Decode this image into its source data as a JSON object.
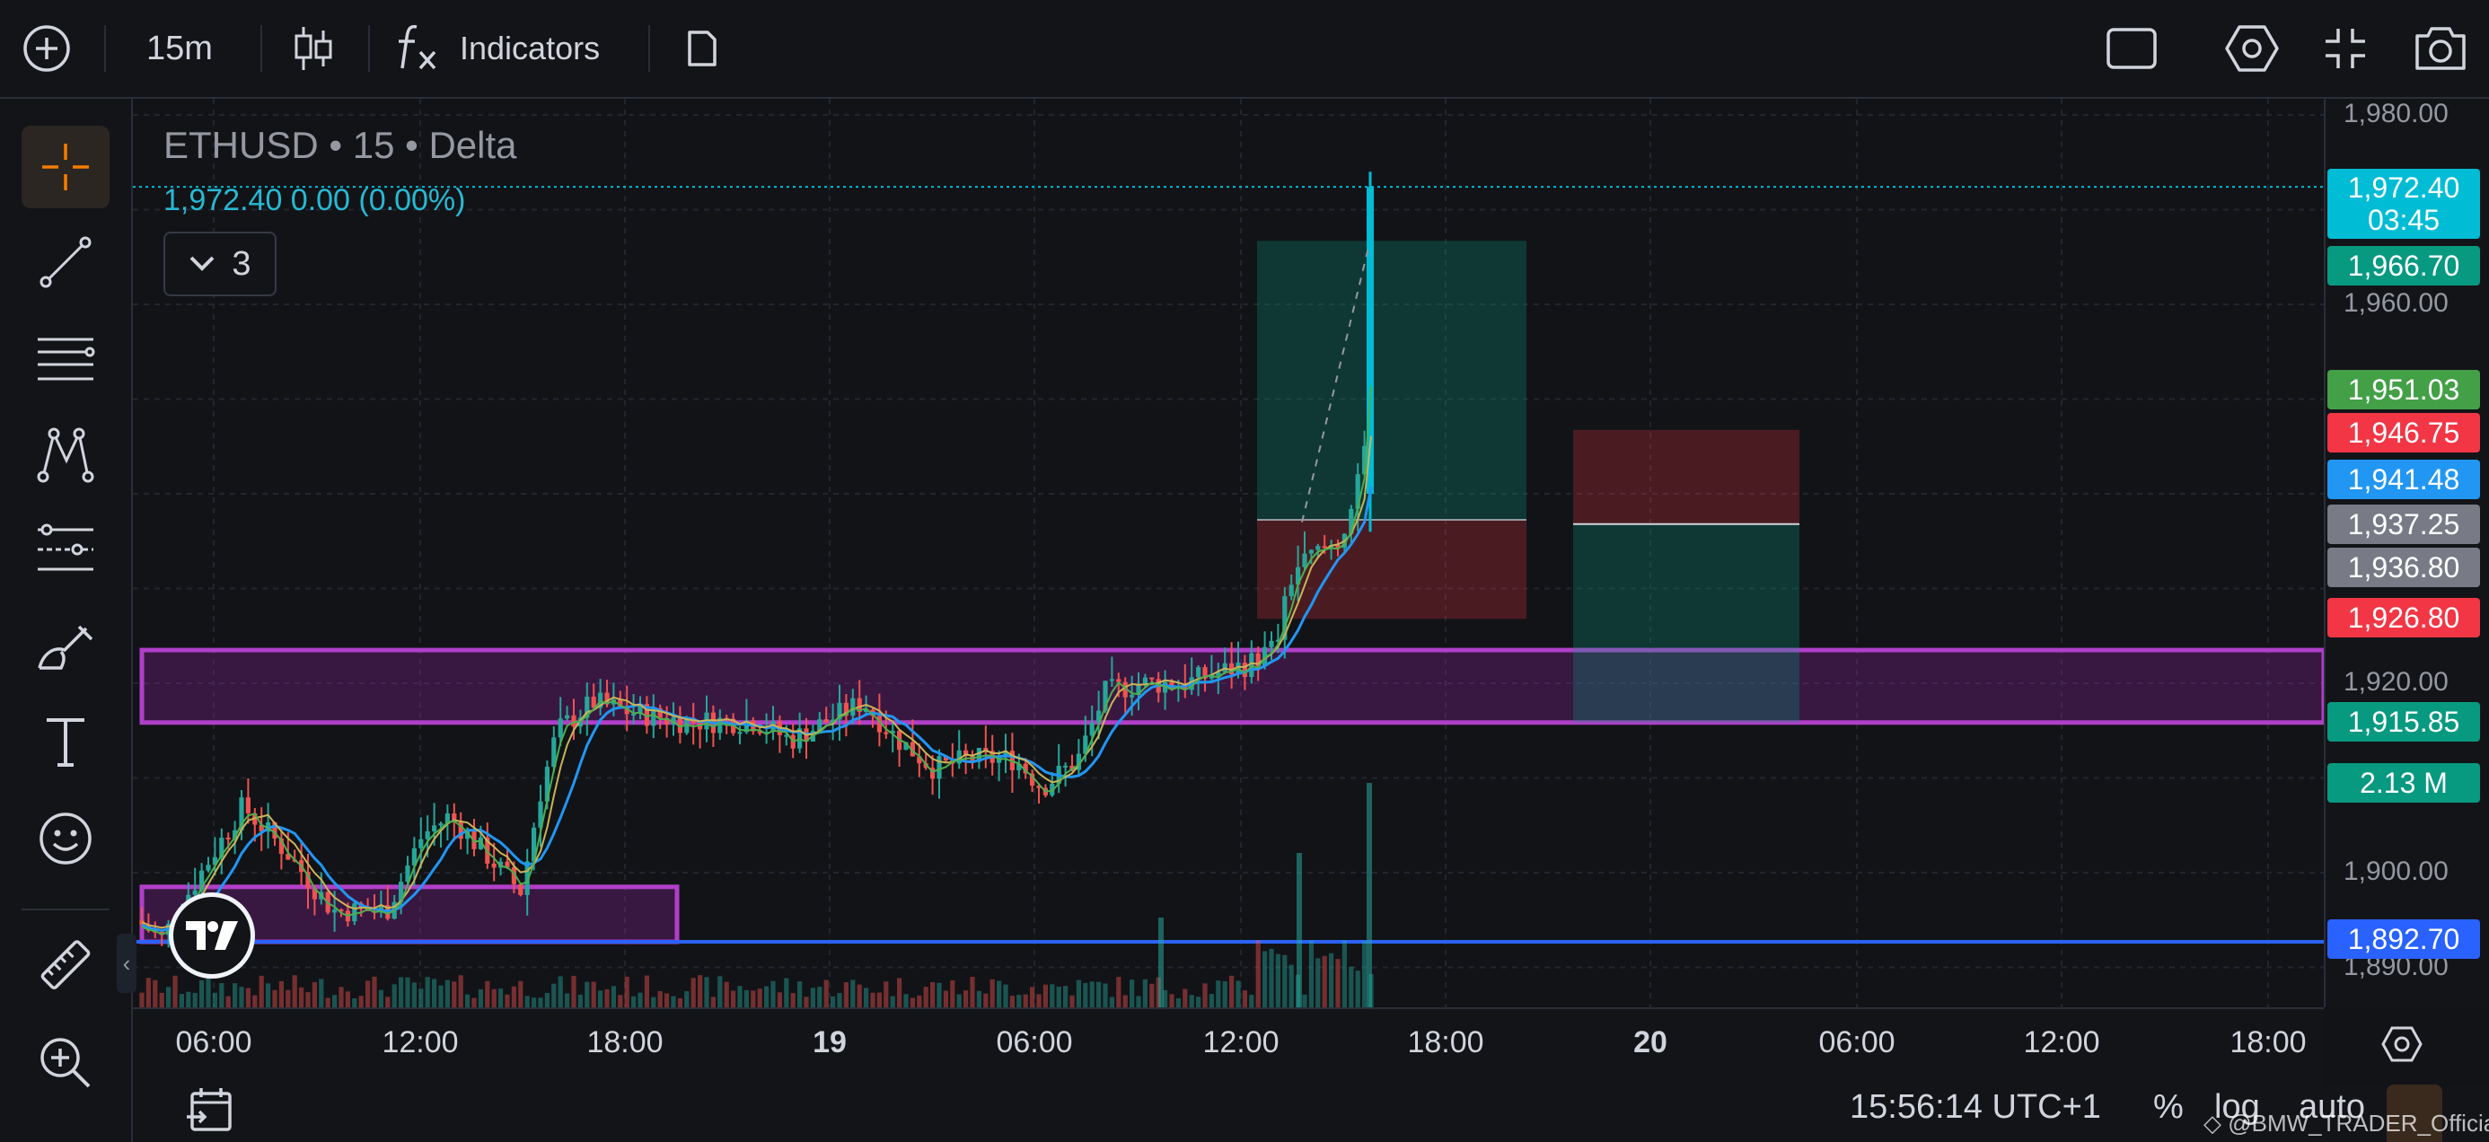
{
  "toolbar": {
    "interval": "15m",
    "indicators_label": "Indicators"
  },
  "legend": {
    "symbol_line": "ETHUSD • 15 • Delta",
    "price_line": "1,972.40  0.00 (0.00%)",
    "collapse_count": "3"
  },
  "price_axis": {
    "ticks": [
      "1,980.00",
      "1,960.00",
      "1,920.00",
      "1,900.00",
      "1,890.00"
    ],
    "labels": [
      {
        "text": "1,972.40",
        "sub": "03:45",
        "color": "#00bcd4"
      },
      {
        "text": "1,966.70",
        "color": "#089981"
      },
      {
        "text": "1,951.03",
        "color": "#43a047"
      },
      {
        "text": "1,946.75",
        "color": "#f23645"
      },
      {
        "text": "1,941.48",
        "color": "#2196f3"
      },
      {
        "text": "1,937.25",
        "color": "#787b86"
      },
      {
        "text": "1,936.80",
        "color": "#787b86"
      },
      {
        "text": "1,926.80",
        "color": "#f23645"
      },
      {
        "text": "1,915.85",
        "color": "#089981"
      },
      {
        "text": "2.13 M",
        "color": "#089981"
      },
      {
        "text": "1,892.70",
        "color": "#2962ff"
      }
    ]
  },
  "time_axis": [
    "06:00",
    "12:00",
    "18:00",
    "19",
    "06:00",
    "12:00",
    "18:00",
    "20",
    "06:00",
    "12:00",
    "18:00"
  ],
  "bottombar": {
    "clock": "15:56:14 UTC+1",
    "percent": "%",
    "log": "log",
    "auto": "auto",
    "watermark": "@BMW_TRADER_Official"
  },
  "colors": {
    "up": "#26a69a",
    "down": "#ef5350",
    "zone": "#9c27b0",
    "line_blue": "#2962ff",
    "current": "#00bcd4"
  },
  "icons": {
    "add": "plus-circle-icon",
    "candles": "candles-icon",
    "indicators": "fx-icon",
    "template": "document-icon",
    "layout": "square-icon",
    "settings": "hexagon-gear-icon",
    "fullscreen": "collapse-icon",
    "snapshot": "camera-icon"
  },
  "chart_data": {
    "type": "candlestick",
    "symbol": "ETHUSD",
    "interval": "15",
    "exchange": "Delta",
    "last_price": 1972.4,
    "ylim": [
      1885,
      1985
    ],
    "x_ticks": [
      "06:00",
      "12:00",
      "18:00",
      "19",
      "06:00",
      "12:00",
      "18:00",
      "20",
      "06:00",
      "12:00",
      "18:00"
    ],
    "zones": [
      {
        "kind": "supply-demand",
        "low": 1915.85,
        "high": 1923.5
      },
      {
        "kind": "supply-demand",
        "low": 1892.7,
        "high": 1898.5
      }
    ],
    "horizontal_lines": [
      1892.7
    ],
    "positions": [
      {
        "kind": "long",
        "entry": 1937.25,
        "target": 1966.7,
        "stop": 1926.8
      },
      {
        "kind": "short",
        "entry": 1936.8,
        "target": 1915.85,
        "stop": 1946.75
      }
    ],
    "volume_last": "2.13 M"
  }
}
